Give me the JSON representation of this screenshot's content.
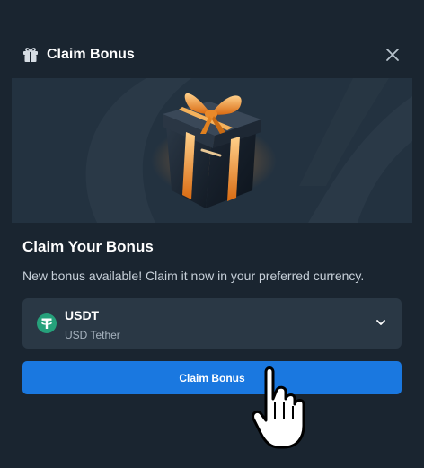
{
  "header": {
    "title": "Claim Bonus",
    "icon": "gift-icon",
    "close_icon": "close-icon"
  },
  "content": {
    "heading": "Claim Your Bonus",
    "subtext": "New bonus available! Claim it now in your preferred currency."
  },
  "currency": {
    "code": "USDT",
    "name": "USD Tether",
    "icon": "tether-icon"
  },
  "action": {
    "claim_label": "Claim Bonus"
  },
  "colors": {
    "background": "#1a2530",
    "banner": "#233240",
    "select": "#2a3845",
    "primary": "#1a78e0",
    "tether": "#26a17b"
  }
}
